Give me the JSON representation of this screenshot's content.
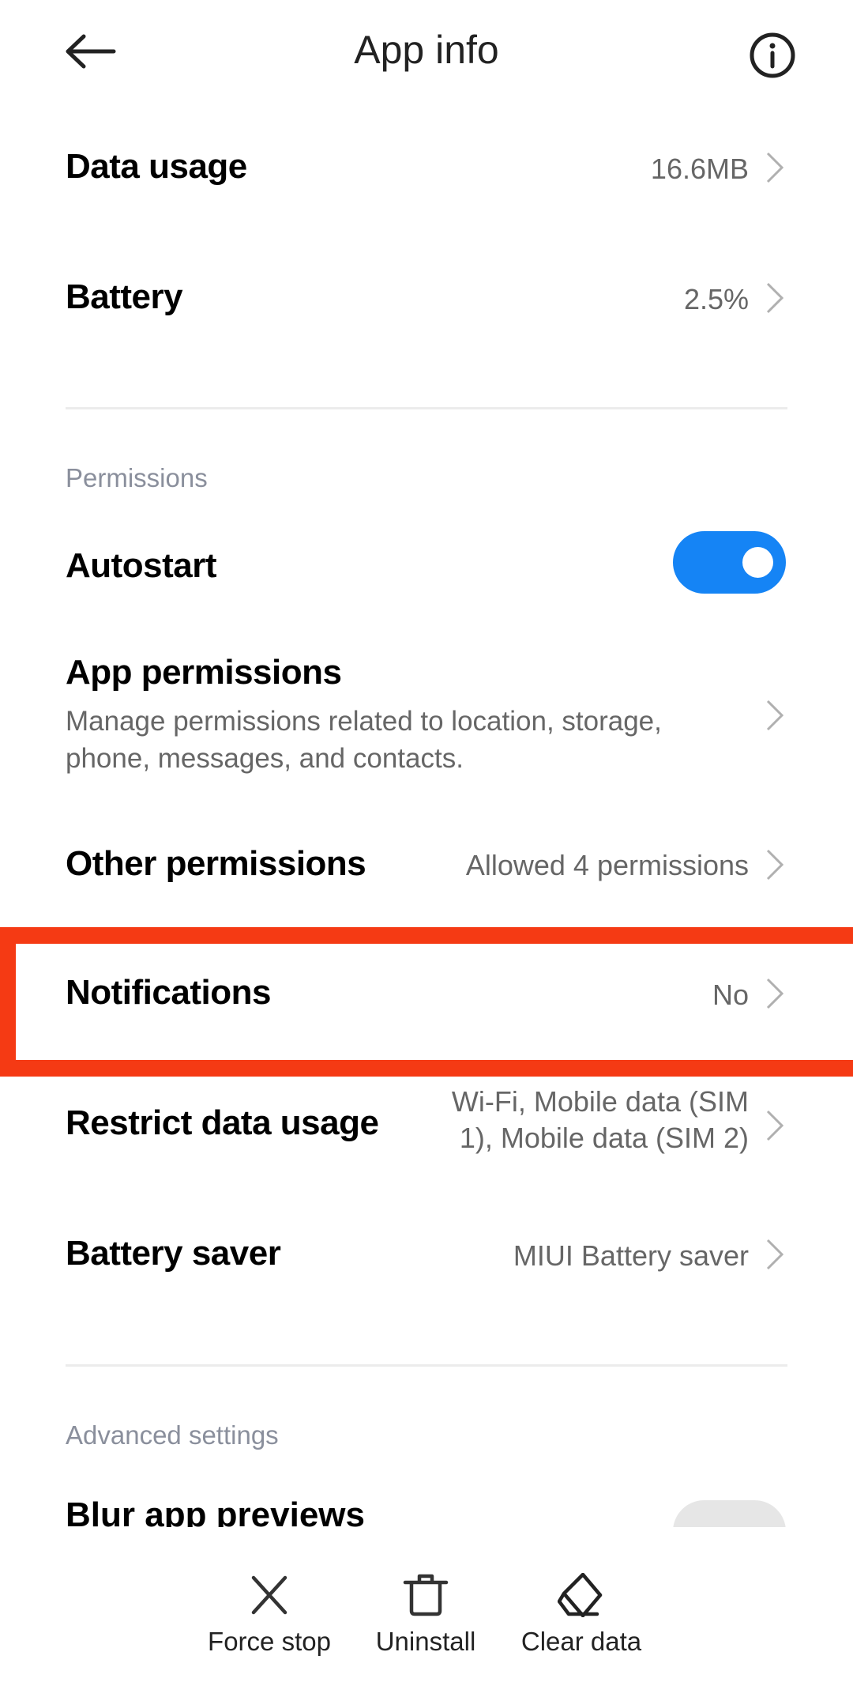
{
  "header": {
    "title": "App info",
    "back_icon": "arrow-left-icon",
    "info_icon": "info-circle-icon"
  },
  "usage": {
    "data_usage": {
      "label": "Data usage",
      "value": "16.6MB"
    },
    "battery": {
      "label": "Battery",
      "value": "2.5%"
    }
  },
  "permissions": {
    "section_title": "Permissions",
    "autostart": {
      "label": "Autostart",
      "enabled": true
    },
    "app_permissions": {
      "label": "App permissions",
      "description_line1": "Manage permissions related to location, storage,",
      "description_line2": "phone, messages, and contacts."
    },
    "other_permissions": {
      "label": "Other permissions",
      "value": "Allowed 4 permissions"
    },
    "notifications": {
      "label": "Notifications",
      "value": "No"
    },
    "restrict_data_usage": {
      "label": "Restrict data usage",
      "value_line1": "Wi-Fi, Mobile data (SIM",
      "value_line2": "1), Mobile data (SIM 2)"
    },
    "battery_saver": {
      "label": "Battery saver",
      "value": "MIUI Battery saver"
    }
  },
  "advanced": {
    "section_title": "Advanced settings",
    "blur_app_previews": {
      "label": "Blur app previews",
      "enabled": false
    }
  },
  "bottom_actions": [
    {
      "label": "Force stop",
      "icon": "close-x-icon"
    },
    {
      "label": "Uninstall",
      "icon": "trash-icon"
    },
    {
      "label": "Clear data",
      "icon": "eraser-icon"
    }
  ],
  "colors": {
    "accent": "#1584f5",
    "highlight": "#f53a14",
    "section_header": "#8a8f9c",
    "secondary_text": "#666666"
  }
}
